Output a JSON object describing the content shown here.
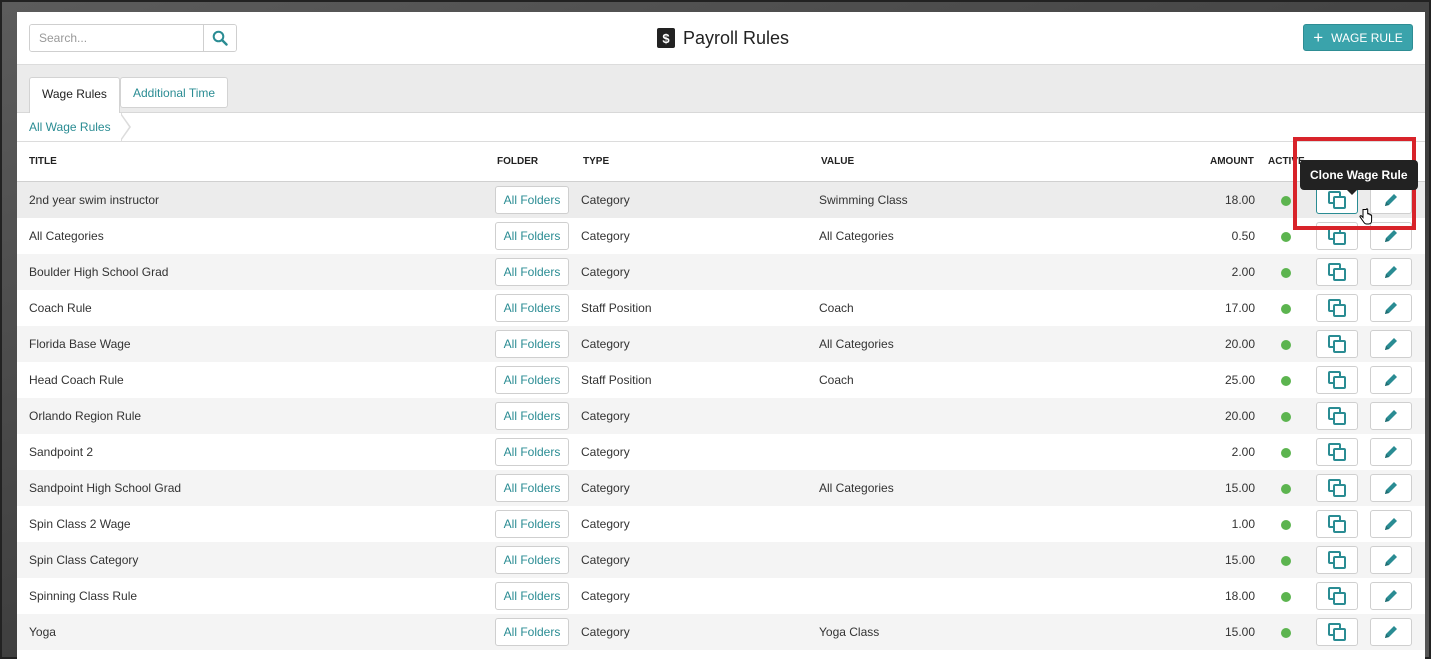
{
  "header": {
    "search_placeholder": "Search...",
    "title": "Payroll Rules",
    "add_button_label": "WAGE RULE"
  },
  "tabs": [
    {
      "label": "Wage Rules",
      "active": true
    },
    {
      "label": "Additional Time",
      "active": false
    }
  ],
  "breadcrumb": "All Wage Rules",
  "columns": {
    "title": "TITLE",
    "folder": "FOLDER",
    "type": "TYPE",
    "value": "VALUE",
    "amount": "AMOUNT",
    "active": "ACTIVE"
  },
  "rows": [
    {
      "title": "2nd year swim instructor",
      "folder": "All Folders",
      "type": "Category",
      "value": "Swimming Class",
      "amount": "18.00"
    },
    {
      "title": "All Categories",
      "folder": "All Folders",
      "type": "Category",
      "value": "All Categories",
      "amount": "0.50"
    },
    {
      "title": "Boulder High School Grad",
      "folder": "All Folders",
      "type": "Category",
      "value": "",
      "amount": "2.00"
    },
    {
      "title": "Coach Rule",
      "folder": "All Folders",
      "type": "Staff Position",
      "value": "Coach",
      "amount": "17.00"
    },
    {
      "title": "Florida Base Wage",
      "folder": "All Folders",
      "type": "Category",
      "value": "All Categories",
      "amount": "20.00"
    },
    {
      "title": "Head Coach Rule",
      "folder": "All Folders",
      "type": "Staff Position",
      "value": "Coach",
      "amount": "25.00"
    },
    {
      "title": "Orlando Region Rule",
      "folder": "All Folders",
      "type": "Category",
      "value": "",
      "amount": "20.00"
    },
    {
      "title": "Sandpoint 2",
      "folder": "All Folders",
      "type": "Category",
      "value": "",
      "amount": "2.00"
    },
    {
      "title": "Sandpoint High School Grad",
      "folder": "All Folders",
      "type": "Category",
      "value": "All Categories",
      "amount": "15.00"
    },
    {
      "title": "Spin Class 2 Wage",
      "folder": "All Folders",
      "type": "Category",
      "value": "",
      "amount": "1.00"
    },
    {
      "title": "Spin Class Category",
      "folder": "All Folders",
      "type": "Category",
      "value": "",
      "amount": "15.00"
    },
    {
      "title": "Spinning Class Rule",
      "folder": "All Folders",
      "type": "Category",
      "value": "",
      "amount": "18.00"
    },
    {
      "title": "Yoga",
      "folder": "All Folders",
      "type": "Category",
      "value": "Yoga Class",
      "amount": "15.00"
    }
  ],
  "tooltip": "Clone Wage Rule",
  "colors": {
    "accent": "#3aa3ab",
    "link": "#2a8c93",
    "active_dot": "#5cb44f",
    "highlight": "#d8232a"
  },
  "icons": {
    "search": "search-icon",
    "dollar": "dollar-sign-icon",
    "plus": "plus-icon",
    "clone": "clone-icon",
    "edit": "pencil-icon"
  }
}
